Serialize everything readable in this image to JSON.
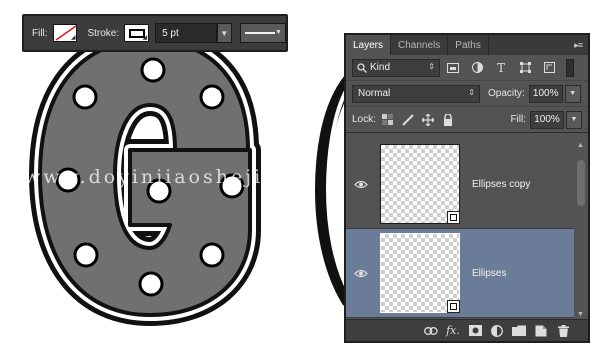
{
  "watermark": "www.doyinjiaosheji.co",
  "options_bar": {
    "fill_label": "Fill:",
    "stroke_label": "Stroke:",
    "stroke_width": "5 pt"
  },
  "layers_panel": {
    "tabs": [
      "Layers",
      "Channels",
      "Paths"
    ],
    "active_tab": "Layers",
    "filter_kind": "Kind",
    "blend_mode": "Normal",
    "opacity_label": "Opacity:",
    "opacity_value": "100%",
    "lock_label": "Lock:",
    "fill_label": "Fill:",
    "fill_value": "100%",
    "layers": [
      {
        "name": "Ellipses copy",
        "visible": true,
        "selected": false
      },
      {
        "name": "Ellipses",
        "visible": true,
        "selected": true
      }
    ],
    "bottom_icons": [
      "link-icon",
      "fx-icon",
      "mask-icon",
      "adjustment-icon",
      "folder-icon",
      "new-layer-icon",
      "trash-icon"
    ],
    "fx_label": "fx."
  },
  "colors": {
    "panel_bg": "#535353",
    "selected_layer": "#6b7c98",
    "letter_fill": "#6e6e6e",
    "letter_outline": "#000000"
  }
}
